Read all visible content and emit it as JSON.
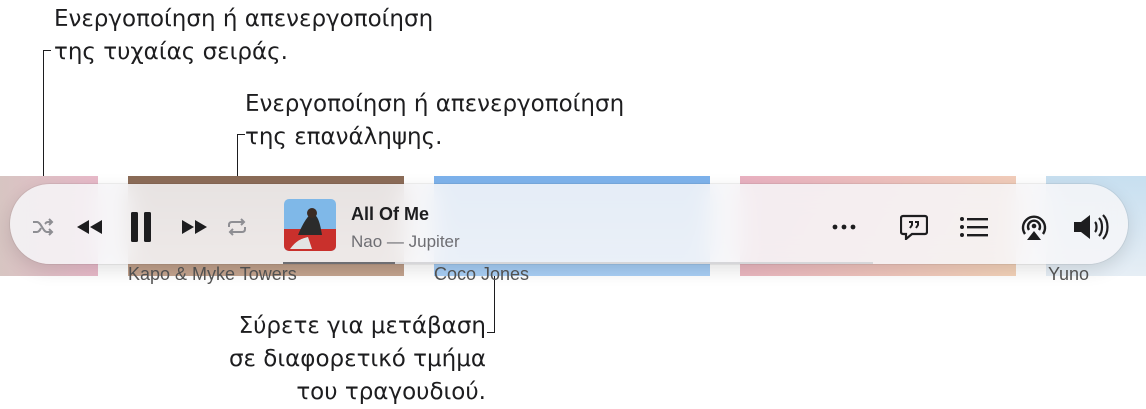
{
  "callouts": {
    "shuffle": [
      "Ενεργοποίηση ή απενεργοποίηση",
      "της τυχαίας σειράς."
    ],
    "repeat": [
      "Ενεργοποίηση ή απενεργοποίηση",
      "της επανάληψης."
    ],
    "scrubber": [
      "Σύρετε για μετάβαση",
      "σε διαφορετικό τμήμα",
      "του τραγουδιού."
    ]
  },
  "background": {
    "tile_titles": [
      "Kapo & Myke Towers",
      "Coco Jones",
      "Yuno"
    ],
    "colors": [
      "#d8c9c0",
      "#7a5a48",
      "#7fb4ea",
      "#f0b9c7",
      "#a9d3ea"
    ]
  },
  "now_playing": {
    "title": "All Of Me",
    "subtitle": "Nao — Jupiter",
    "progress": 0.19
  },
  "controls": {
    "shuffle_icon": "shuffle-icon",
    "previous_icon": "backward-icon",
    "pause_icon": "pause-icon",
    "next_icon": "forward-icon",
    "repeat_icon": "repeat-icon",
    "more_icon": "ellipsis-icon",
    "lyrics_icon": "lyrics-icon",
    "queue_icon": "list-icon",
    "airplay_icon": "airplay-icon",
    "volume_icon": "speaker-icon"
  },
  "colors": {
    "icon": "#1d1d1f",
    "icon_dim": "#8e8e93",
    "accent": "#fc3c44"
  }
}
